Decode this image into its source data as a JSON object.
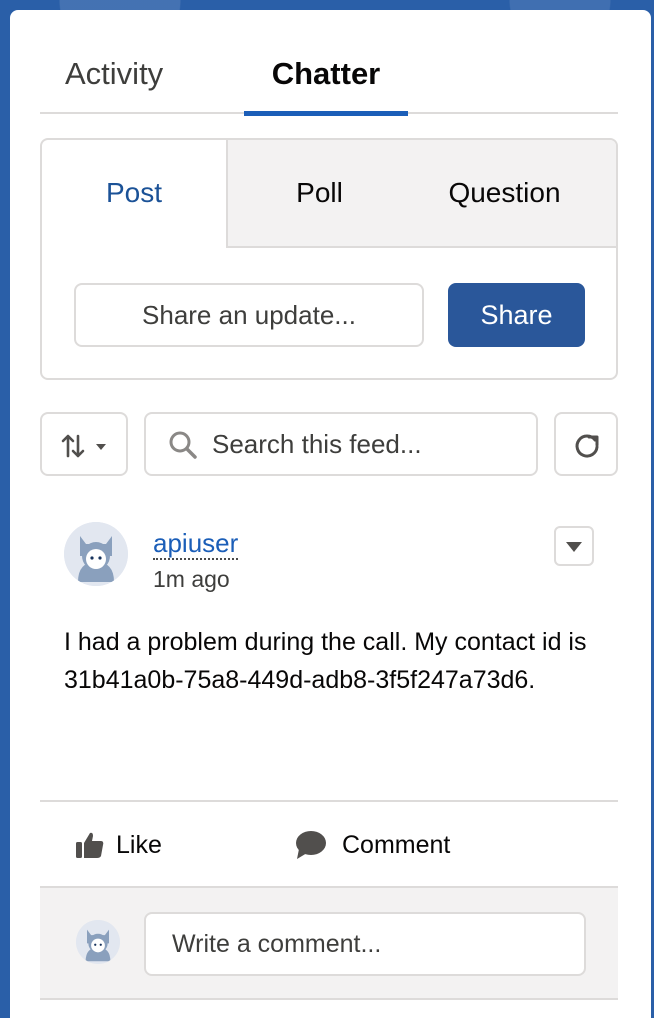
{
  "tabs": {
    "activity": "Activity",
    "chatter": "Chatter"
  },
  "publisher": {
    "tabs": {
      "post": "Post",
      "poll": "Poll",
      "question": "Question"
    },
    "update_placeholder": "Share an update...",
    "share_label": "Share"
  },
  "feed": {
    "search_placeholder": "Search this feed..."
  },
  "post": {
    "author": "apiuser",
    "timestamp": "1m ago",
    "body": "I had a problem during the call. My contact id is 31b41a0b-75a8-449d-adb8-3f5f247a73d6.",
    "actions": {
      "like": "Like",
      "comment": "Comment"
    },
    "comment_placeholder": "Write a comment..."
  },
  "colors": {
    "brand_blue": "#2a579a",
    "link_blue": "#1b5eb8",
    "border": "#dddbda",
    "muted_bg": "#f3f2f2"
  }
}
